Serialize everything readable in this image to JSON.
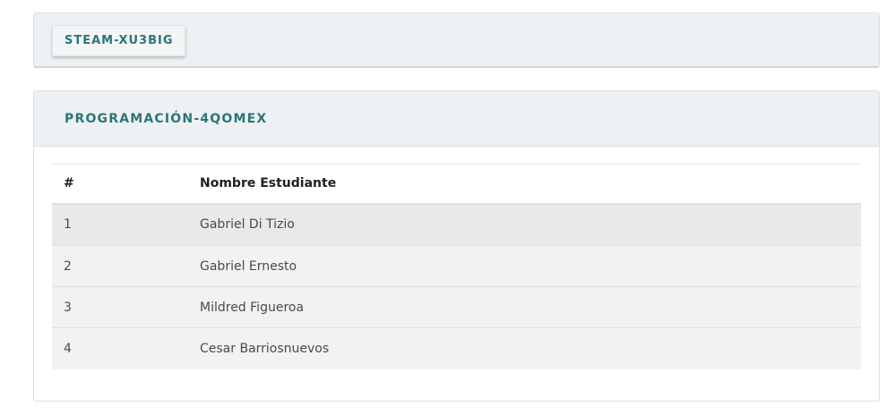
{
  "top_card": {
    "course_label": "STEAM-XU3BIG"
  },
  "main_card": {
    "title": "PROGRAMACIÓN-4QOMEX",
    "table": {
      "columns": [
        "#",
        "Nombre Estudiante"
      ],
      "rows": [
        {
          "num": "1",
          "name": "Gabriel Di Tizio"
        },
        {
          "num": "2",
          "name": "Gabriel Ernesto"
        },
        {
          "num": "3",
          "name": "Mildred Figueroa"
        },
        {
          "num": "4",
          "name": "Cesar Barriosnuevos"
        }
      ]
    }
  },
  "colors": {
    "accent": "#2c7577",
    "header_bg": "#eef1f3",
    "row_bg": "#f2f2f2",
    "row_hover_bg": "#e9e9e9"
  }
}
